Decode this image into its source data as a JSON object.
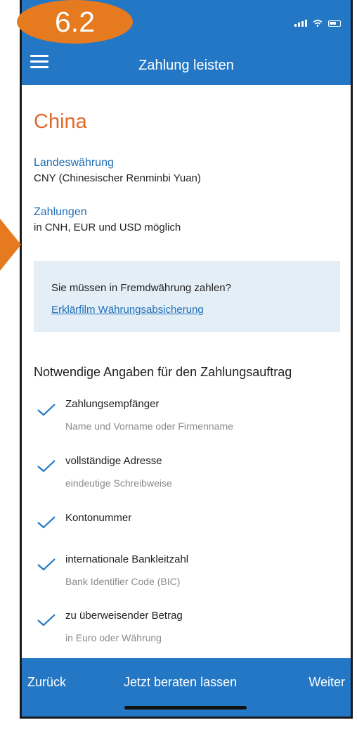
{
  "badge": {
    "label": "6.2"
  },
  "header": {
    "title": "Zahlung leisten"
  },
  "country": "China",
  "currency": {
    "label": "Landeswährung",
    "value": "CNY (Chinesischer Renminbi Yuan)"
  },
  "payments": {
    "label": "Zahlungen",
    "value": "in CNH, EUR und USD möglich"
  },
  "info_box": {
    "question": "Sie müssen in Fremdwährung zahlen?",
    "link": "Erklärfilm Währungsabsicherung"
  },
  "requirements": {
    "heading": "Notwendige Angaben für den Zahlungsauftrag",
    "items": [
      {
        "title": "Zahlungsempfänger",
        "sub": "Name und Vorname oder Firmenname"
      },
      {
        "title": "vollständige Adresse",
        "sub": "eindeutige Schreibweise"
      },
      {
        "title": "Kontonummer",
        "sub": ""
      },
      {
        "title": "internationale Bankleitzahl",
        "sub": "Bank Identifier Code (BIC)"
      },
      {
        "title": "zu überweisender Betrag",
        "sub": "in Euro oder Währung"
      }
    ]
  },
  "bottom_bar": {
    "back": "Zurück",
    "advise": "Jetzt beraten lassen",
    "next": "Weiter"
  },
  "colors": {
    "brand_blue": "#2377c5",
    "accent_orange": "#e57a1f",
    "country_orange": "#e2682a",
    "info_bg": "#e3eef7"
  },
  "icons": [
    "menu-icon",
    "signal-icon",
    "wifi-icon",
    "battery-icon",
    "checkmark-icon"
  ]
}
